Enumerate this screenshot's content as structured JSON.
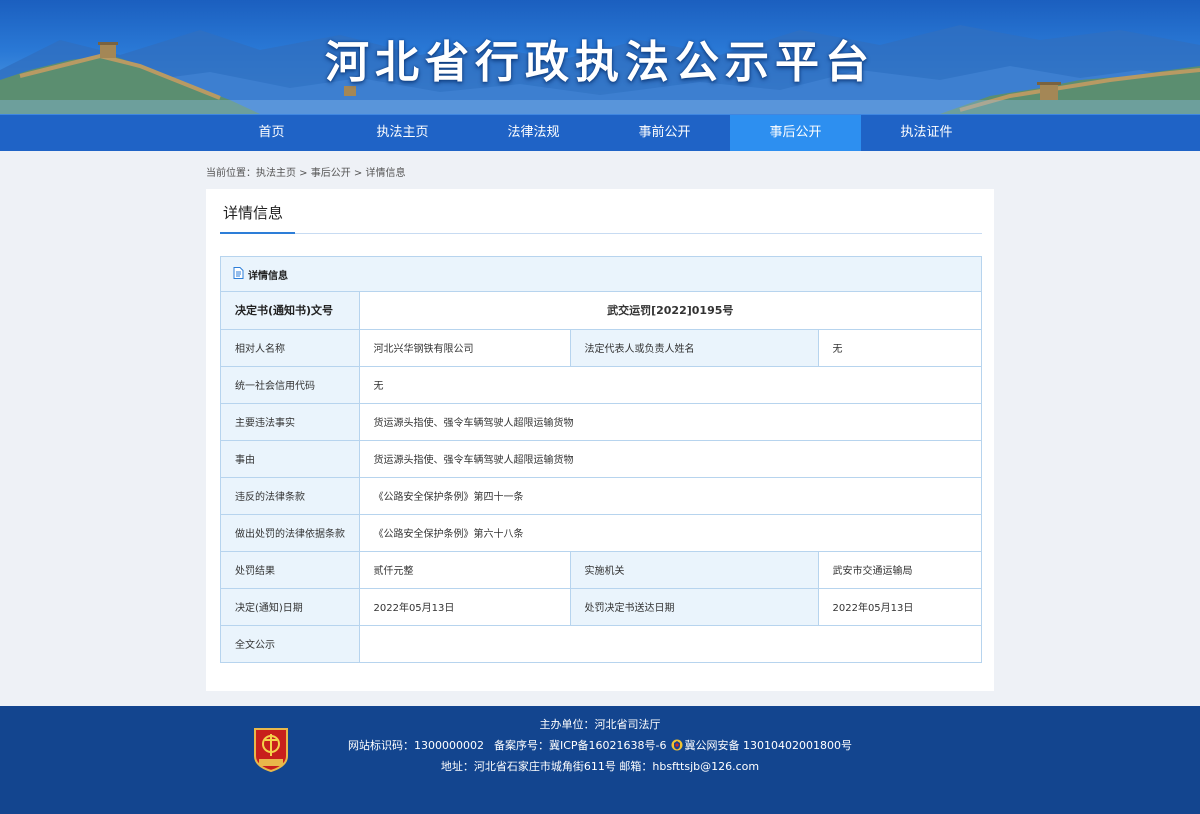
{
  "header": {
    "site_title": "河北省行政执法公示平台"
  },
  "nav": {
    "items": [
      {
        "label": "首页"
      },
      {
        "label": "执法主页"
      },
      {
        "label": "法律法规"
      },
      {
        "label": "事前公开"
      },
      {
        "label": "事后公开",
        "active": true
      },
      {
        "label": "执法证件"
      }
    ]
  },
  "breadcrumb": {
    "text": "当前位置：执法主页 > 事后公开 > 详情信息"
  },
  "card": {
    "title": "详情信息",
    "section_title": "详情信息",
    "doc_label": "决定书(通知书)文号",
    "doc_value": "武交运罚[2022]0195号",
    "rows": {
      "party_name_label": "相对人名称",
      "party_name_value": "河北兴华钢铁有限公司",
      "legal_rep_label": "法定代表人或负责人姓名",
      "legal_rep_value": "无",
      "credit_code_label": "统一社会信用代码",
      "credit_code_value": "无",
      "facts_label": "主要违法事实",
      "facts_value": "货运源头指使、强令车辆驾驶人超限运输货物",
      "reason_label": "事由",
      "reason_value": "货运源头指使、强令车辆驾驶人超限运输货物",
      "violated_law_label": "违反的法律条款",
      "violated_law_value": "《公路安全保护条例》第四十一条",
      "basis_label": "做出处罚的法律依据条款",
      "basis_value": "《公路安全保护条例》第六十八条",
      "result_label": "处罚结果",
      "result_value": "贰仟元整",
      "agency_label": "实施机关",
      "agency_value": "武安市交通运输局",
      "decision_date_label": "决定(通知)日期",
      "decision_date_value": "2022年05月13日",
      "delivery_date_label": "处罚决定书送达日期",
      "delivery_date_value": "2022年05月13日",
      "fulltext_label": "全文公示",
      "fulltext_value": ""
    }
  },
  "footer": {
    "sponsor": "主办单位：河北省司法厅",
    "site_id": "网站标识码：1300000002",
    "icp": "备案序号：冀ICP备16021638号-6",
    "police": "冀公网安备 13010402001800号",
    "address": "地址：河北省石家庄市城角街611号  邮箱：hbsfttsjb@126.com",
    "logo_text": "党政机关"
  },
  "colors": {
    "nav_bg": "#1f63c6",
    "nav_active": "#2d8ff0",
    "footer_bg": "#13458f",
    "label_bg": "#eaf4fc",
    "border": "#b7d4ee"
  }
}
